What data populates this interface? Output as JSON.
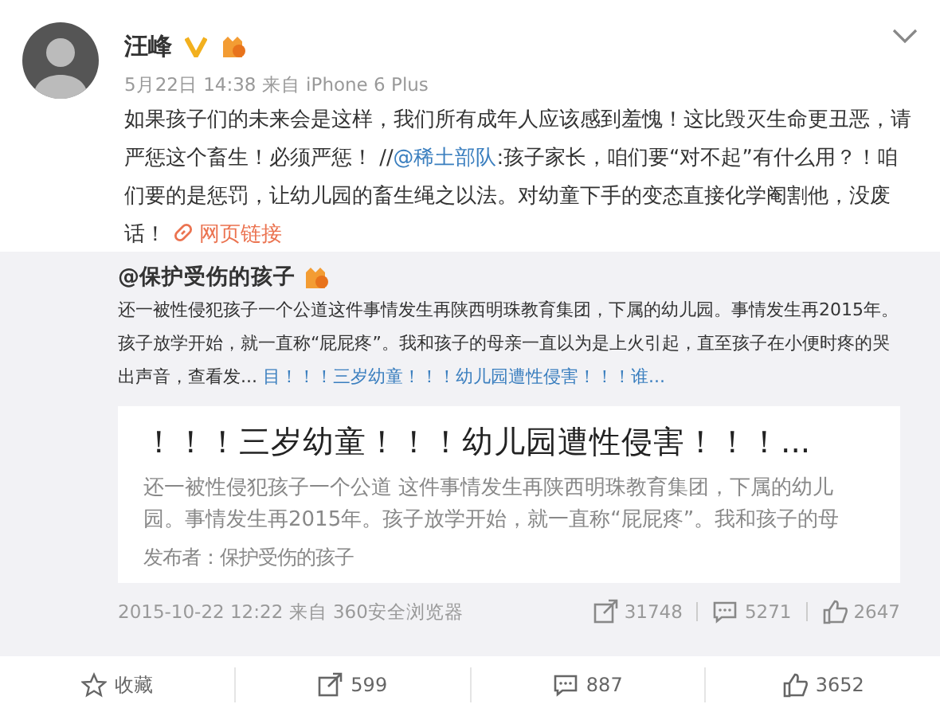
{
  "post": {
    "author": "汪峰",
    "meta": "5月22日 14:38 来自 iPhone 6 Plus",
    "body": [
      {
        "kind": "text",
        "text": "如果孩子们的未来会是这样，我们所有成年人应该感到羞愧！这比毁灭生命更丑恶，请严惩这个畜生！必须严惩！ //"
      },
      {
        "kind": "mention",
        "text": "@稀土部队"
      },
      {
        "kind": "text",
        "text": ":孩子家长，咱们要“对不起”有什么用？！咱们要的是惩罚，让幼儿园的畜生绳之以法。对幼童下手的变态直接化学阉割他，没废话！ "
      },
      {
        "kind": "weblink",
        "text": "网页链接"
      }
    ]
  },
  "repost": {
    "author": "@保护受伤的孩子",
    "body": [
      {
        "kind": "text",
        "text": "还一被性侵犯孩子一个公道这件事情发生再陕西明珠教育集团，下属的幼儿园。事情发生再2015年。孩子放学开始，就一直称“屁屁疼”。我和孩子的母亲一直以为是上火引起，直至孩子在小便时疼的哭出声音，查看发... "
      },
      {
        "kind": "mention",
        "text": "目！！！三岁幼童！！！幼儿园遭性侵害！！！谁..."
      }
    ],
    "card": {
      "title": "！！！三岁幼童！！！幼儿园遭性侵害！！！...",
      "description": "还一被性侵犯孩子一个公道 这件事情发生再陕西明珠教育集团，下属的幼儿园。事情发生再2015年。孩子放学开始，就一直称“屁屁疼”。我和孩子的母",
      "publisher": "发布者：保护受伤的孩子"
    },
    "meta": "2015-10-22 12:22 来自 360安全浏览器",
    "stats": [
      {
        "kind": "repost",
        "text": "31748"
      },
      {
        "kind": "comment",
        "text": "5271"
      },
      {
        "kind": "like",
        "text": "2647"
      }
    ]
  },
  "actions": [
    {
      "kind": "favorite",
      "text": "收藏"
    },
    {
      "kind": "repost",
      "text": "599"
    },
    {
      "kind": "comment",
      "text": "887"
    },
    {
      "kind": "like",
      "text": "3652"
    }
  ]
}
